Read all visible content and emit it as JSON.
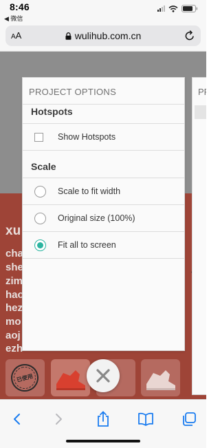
{
  "status_bar": {
    "time": "8:46",
    "back_app": "◀ 微信"
  },
  "browser": {
    "aa_small": "A",
    "aa_large": "A",
    "url": "wulihub.com.cn"
  },
  "background": {
    "heading": "xu",
    "lines": [
      "cha",
      "she",
      "zim",
      "hao",
      "hez",
      "mo",
      "aoj",
      "ezh"
    ],
    "stamp_text": "已使用"
  },
  "peek_panel": {
    "title": "PR"
  },
  "options_panel": {
    "title": "PROJECT OPTIONS",
    "hotspots_section": "Hotspots",
    "show_hotspots_label": "Show Hotspots",
    "show_hotspots_checked": false,
    "scale_section": "Scale",
    "scale_options": [
      {
        "label": "Scale to fit width",
        "selected": false
      },
      {
        "label": "Original size (100%)",
        "selected": false
      },
      {
        "label": "Fit all to screen",
        "selected": true
      }
    ]
  },
  "colors": {
    "accent": "#2bb4a0",
    "ios_blue": "#1a7cf0",
    "page_red": "#9e4437",
    "page_gray": "#8d8d8d"
  }
}
